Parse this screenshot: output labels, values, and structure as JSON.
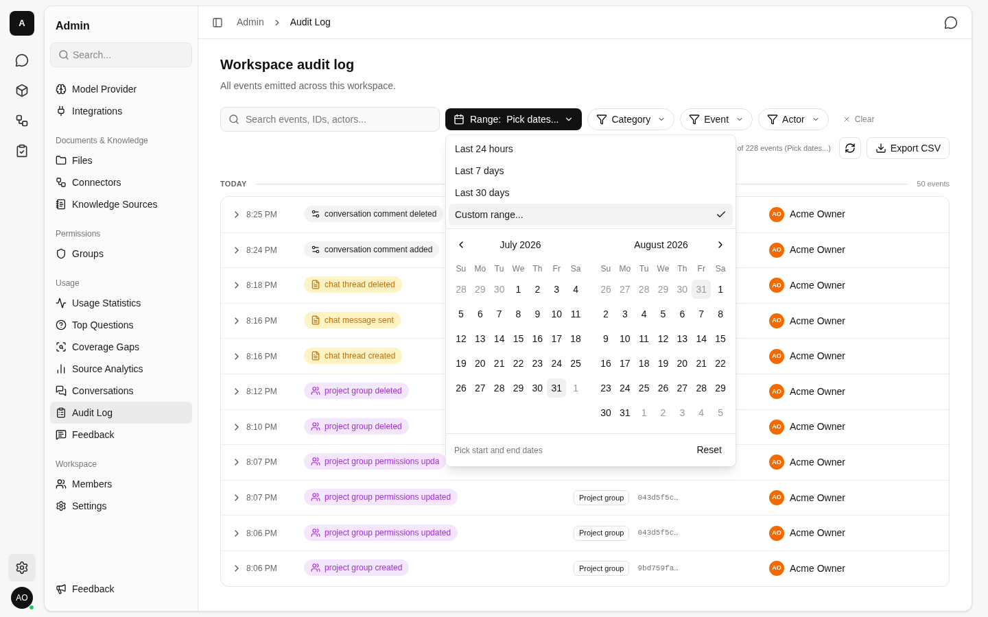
{
  "rail": {
    "logo": "A",
    "avatar": "AO",
    "settings_active": true,
    "online": true
  },
  "sidebar": {
    "title": "Admin",
    "search": {
      "placeholder": "Search..."
    },
    "sections": [
      {
        "items": [
          {
            "label": "Model Provider",
            "selected": false
          },
          {
            "label": "Integrations",
            "selected": false
          }
        ]
      },
      {
        "heading": "Documents & Knowledge",
        "items": [
          {
            "label": "Files",
            "selected": false
          },
          {
            "label": "Connectors",
            "selected": false
          },
          {
            "label": "Knowledge Sources",
            "selected": false
          }
        ]
      },
      {
        "heading": "Permissions",
        "items": [
          {
            "label": "Groups",
            "selected": false
          }
        ]
      },
      {
        "heading": "Usage",
        "items": [
          {
            "label": "Usage Statistics",
            "selected": false
          },
          {
            "label": "Top Questions",
            "selected": false
          },
          {
            "label": "Coverage Gaps",
            "selected": false
          },
          {
            "label": "Source Analytics",
            "selected": false
          },
          {
            "label": "Conversations",
            "selected": false
          },
          {
            "label": "Audit Log",
            "selected": true
          },
          {
            "label": "Feedback",
            "selected": false
          }
        ]
      },
      {
        "heading": "Workspace",
        "items": [
          {
            "label": "Members",
            "selected": false
          },
          {
            "label": "Settings",
            "selected": false
          }
        ]
      }
    ],
    "footer": "Feedback"
  },
  "breadcrumb": [
    "Admin",
    "Audit Log"
  ],
  "page": {
    "title": "Workspace audit log",
    "subtitle": "All events emitted across this workspace."
  },
  "filters": {
    "search": {
      "placeholder": "Search events, IDs, actors..."
    },
    "range": {
      "label": "Range:",
      "value": "Pick dates...",
      "open": true
    },
    "chips": [
      "Category",
      "Event",
      "Actor"
    ],
    "clear": "Clear"
  },
  "summary": "of 228 events (Pick dates...)",
  "export": "Export CSV",
  "group": {
    "label": "TODAY",
    "count": "50 events"
  },
  "rows": [
    {
      "time": "8:25 PM",
      "event": "conversation comment deleted",
      "kind": "conversation",
      "actor_initials": "AO",
      "actor": "Acme Owner"
    },
    {
      "time": "8:24 PM",
      "event": "conversation comment added",
      "kind": "conversation",
      "actor_initials": "AO",
      "actor": "Acme Owner"
    },
    {
      "time": "8:18 PM",
      "event": "chat thread deleted",
      "kind": "chat",
      "actor_initials": "AO",
      "actor": "Acme Owner"
    },
    {
      "time": "8:16 PM",
      "event": "chat message sent",
      "kind": "chat",
      "actor_initials": "AO",
      "actor": "Acme Owner"
    },
    {
      "time": "8:16 PM",
      "event": "chat thread created",
      "kind": "chat",
      "actor_initials": "AO",
      "actor": "Acme Owner"
    },
    {
      "time": "8:12 PM",
      "event": "project group deleted",
      "kind": "project",
      "actor_initials": "AO",
      "actor": "Acme Owner"
    },
    {
      "time": "8:10 PM",
      "event": "project group deleted",
      "kind": "project",
      "actor_initials": "AO",
      "actor": "Acme Owner"
    },
    {
      "time": "8:07 PM",
      "event": "project group permissions upda",
      "kind": "project",
      "actor_initials": "AO",
      "actor": "Acme Owner"
    },
    {
      "time": "8:07 PM",
      "event": "project group permissions updated",
      "kind": "project",
      "target": "Project group",
      "id": "043d5f5c…",
      "actor_initials": "AO",
      "actor": "Acme Owner"
    },
    {
      "time": "8:06 PM",
      "event": "project group permissions updated",
      "kind": "project",
      "target": "Project group",
      "id": "043d5f5c…",
      "actor_initials": "AO",
      "actor": "Acme Owner"
    },
    {
      "time": "8:06 PM",
      "event": "project group created",
      "kind": "project",
      "target": "Project group",
      "id": "9bd759fa…",
      "actor_initials": "AO",
      "actor": "Acme Owner"
    }
  ],
  "range_menu": {
    "options": [
      {
        "label": "Last 24 hours",
        "selected": false
      },
      {
        "label": "Last 7 days",
        "selected": false
      },
      {
        "label": "Last 30 days",
        "selected": false
      },
      {
        "label": "Custom range...",
        "selected": true
      }
    ],
    "months": [
      {
        "title": "July 2026",
        "weekdays": [
          "Su",
          "Mo",
          "Tu",
          "We",
          "Th",
          "Fr",
          "Sa"
        ],
        "weeks": [
          [
            {
              "d": "28",
              "outside": true
            },
            {
              "d": "29",
              "outside": true
            },
            {
              "d": "30",
              "outside": true
            },
            {
              "d": "1"
            },
            {
              "d": "2"
            },
            {
              "d": "3"
            },
            {
              "d": "4"
            }
          ],
          [
            {
              "d": "5"
            },
            {
              "d": "6"
            },
            {
              "d": "7"
            },
            {
              "d": "8"
            },
            {
              "d": "9"
            },
            {
              "d": "10"
            },
            {
              "d": "11"
            }
          ],
          [
            {
              "d": "12"
            },
            {
              "d": "13"
            },
            {
              "d": "14"
            },
            {
              "d": "15"
            },
            {
              "d": "16"
            },
            {
              "d": "17"
            },
            {
              "d": "18"
            }
          ],
          [
            {
              "d": "19"
            },
            {
              "d": "20"
            },
            {
              "d": "21"
            },
            {
              "d": "22"
            },
            {
              "d": "23"
            },
            {
              "d": "24"
            },
            {
              "d": "25"
            }
          ],
          [
            {
              "d": "26"
            },
            {
              "d": "27"
            },
            {
              "d": "28"
            },
            {
              "d": "29"
            },
            {
              "d": "30"
            },
            {
              "d": "31",
              "today": true
            },
            {
              "d": "1",
              "outside": true
            }
          ]
        ]
      },
      {
        "title": "August 2026",
        "weekdays": [
          "Su",
          "Mo",
          "Tu",
          "We",
          "Th",
          "Fr",
          "Sa"
        ],
        "weeks": [
          [
            {
              "d": "26",
              "outside": true
            },
            {
              "d": "27",
              "outside": true
            },
            {
              "d": "28",
              "outside": true
            },
            {
              "d": "29",
              "outside": true
            },
            {
              "d": "30",
              "outside": true
            },
            {
              "d": "31",
              "outside": true,
              "today": true
            },
            {
              "d": "1"
            }
          ],
          [
            {
              "d": "2"
            },
            {
              "d": "3"
            },
            {
              "d": "4"
            },
            {
              "d": "5"
            },
            {
              "d": "6"
            },
            {
              "d": "7"
            },
            {
              "d": "8"
            }
          ],
          [
            {
              "d": "9"
            },
            {
              "d": "10"
            },
            {
              "d": "11"
            },
            {
              "d": "12"
            },
            {
              "d": "13"
            },
            {
              "d": "14"
            },
            {
              "d": "15"
            }
          ],
          [
            {
              "d": "16"
            },
            {
              "d": "17"
            },
            {
              "d": "18"
            },
            {
              "d": "19"
            },
            {
              "d": "20"
            },
            {
              "d": "21"
            },
            {
              "d": "22"
            }
          ],
          [
            {
              "d": "23"
            },
            {
              "d": "24"
            },
            {
              "d": "25"
            },
            {
              "d": "26"
            },
            {
              "d": "27"
            },
            {
              "d": "28"
            },
            {
              "d": "29"
            }
          ],
          [
            {
              "d": "30"
            },
            {
              "d": "31"
            },
            {
              "d": "1",
              "outside": true
            },
            {
              "d": "2",
              "outside": true
            },
            {
              "d": "3",
              "outside": true
            },
            {
              "d": "4",
              "outside": true
            },
            {
              "d": "5",
              "outside": true
            }
          ]
        ]
      }
    ],
    "hint": "Pick start and end dates",
    "reset": "Reset"
  }
}
